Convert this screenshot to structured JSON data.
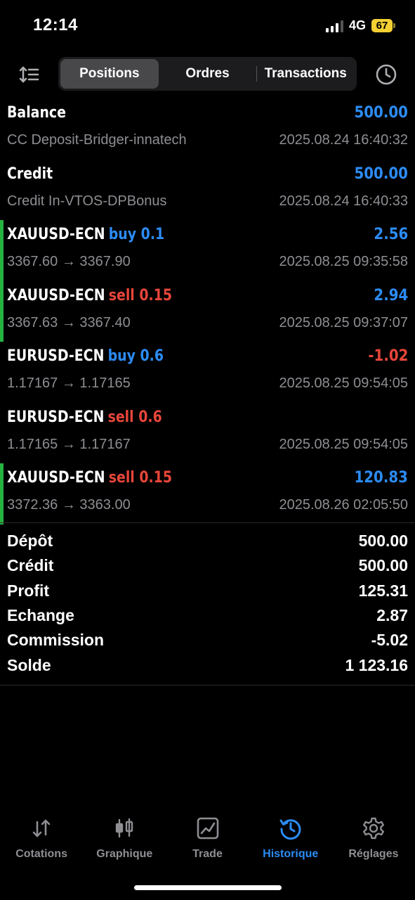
{
  "status_bar": {
    "time": "12:14",
    "network": "4G",
    "battery": "67"
  },
  "toolbar": {
    "tabs": [
      {
        "label": "Positions",
        "active": true
      },
      {
        "label": "Ordres",
        "active": false
      },
      {
        "label": "Transactions",
        "active": false
      }
    ]
  },
  "history": [
    {
      "title": "Balance",
      "side": "",
      "amount": "500.00",
      "amount_color": "blue",
      "subtitle": "CC Deposit-Bridger-innatech",
      "time": "2025.08.24 16:40:32",
      "marked": false
    },
    {
      "title": "Credit",
      "side": "",
      "amount": "500.00",
      "amount_color": "blue",
      "subtitle": "Credit In-VTOS-DPBonus",
      "time": "2025.08.24 16:40:33",
      "marked": false
    },
    {
      "title": "XAUUSD-ECN",
      "side": "buy 0.1",
      "side_color": "blue",
      "amount": "2.56",
      "amount_color": "blue",
      "subtitle": "3367.60 → 3367.90",
      "time": "2025.08.25 09:35:58",
      "marked": true
    },
    {
      "title": "XAUUSD-ECN",
      "side": "sell 0.15",
      "side_color": "red",
      "amount": "2.94",
      "amount_color": "blue",
      "subtitle": "3367.63 → 3367.40",
      "time": "2025.08.25 09:37:07",
      "marked": true
    },
    {
      "title": "EURUSD-ECN",
      "side": "buy 0.6",
      "side_color": "blue",
      "amount": "-1.02",
      "amount_color": "red",
      "subtitle": "1.17167 → 1.17165",
      "time": "2025.08.25 09:54:05",
      "marked": false
    },
    {
      "title": "EURUSD-ECN",
      "side": "sell 0.6",
      "side_color": "red",
      "amount": "",
      "amount_color": "blue",
      "subtitle": "1.17165 → 1.17167",
      "time": "2025.08.25 09:54:05",
      "marked": false
    },
    {
      "title": "XAUUSD-ECN",
      "side": "sell 0.15",
      "side_color": "red",
      "amount": "120.83",
      "amount_color": "blue",
      "subtitle": "3372.36 → 3363.00",
      "time": "2025.08.26 02:05:50",
      "marked": true
    }
  ],
  "summary": [
    {
      "label": "Dépôt",
      "value": "500.00"
    },
    {
      "label": "Crédit",
      "value": "500.00"
    },
    {
      "label": "Profit",
      "value": "125.31"
    },
    {
      "label": "Echange",
      "value": "2.87"
    },
    {
      "label": "Commission",
      "value": "-5.02"
    },
    {
      "label": "Solde",
      "value": "1 123.16"
    }
  ],
  "tabbar": [
    {
      "label": "Cotations",
      "icon": "quotes-arrows-icon",
      "active": false
    },
    {
      "label": "Graphique",
      "icon": "candlestick-chart-icon",
      "active": false
    },
    {
      "label": "Trade",
      "icon": "trade-chart-icon",
      "active": false
    },
    {
      "label": "Historique",
      "icon": "history-clock-icon",
      "active": true
    },
    {
      "label": "Réglages",
      "icon": "settings-gear-icon",
      "active": false
    }
  ],
  "colors": {
    "background": "#000000",
    "accent_blue": "#2c8cf4",
    "loss_red": "#e8463a",
    "marker_green": "#25b340",
    "muted_text": "#8e8e93"
  }
}
